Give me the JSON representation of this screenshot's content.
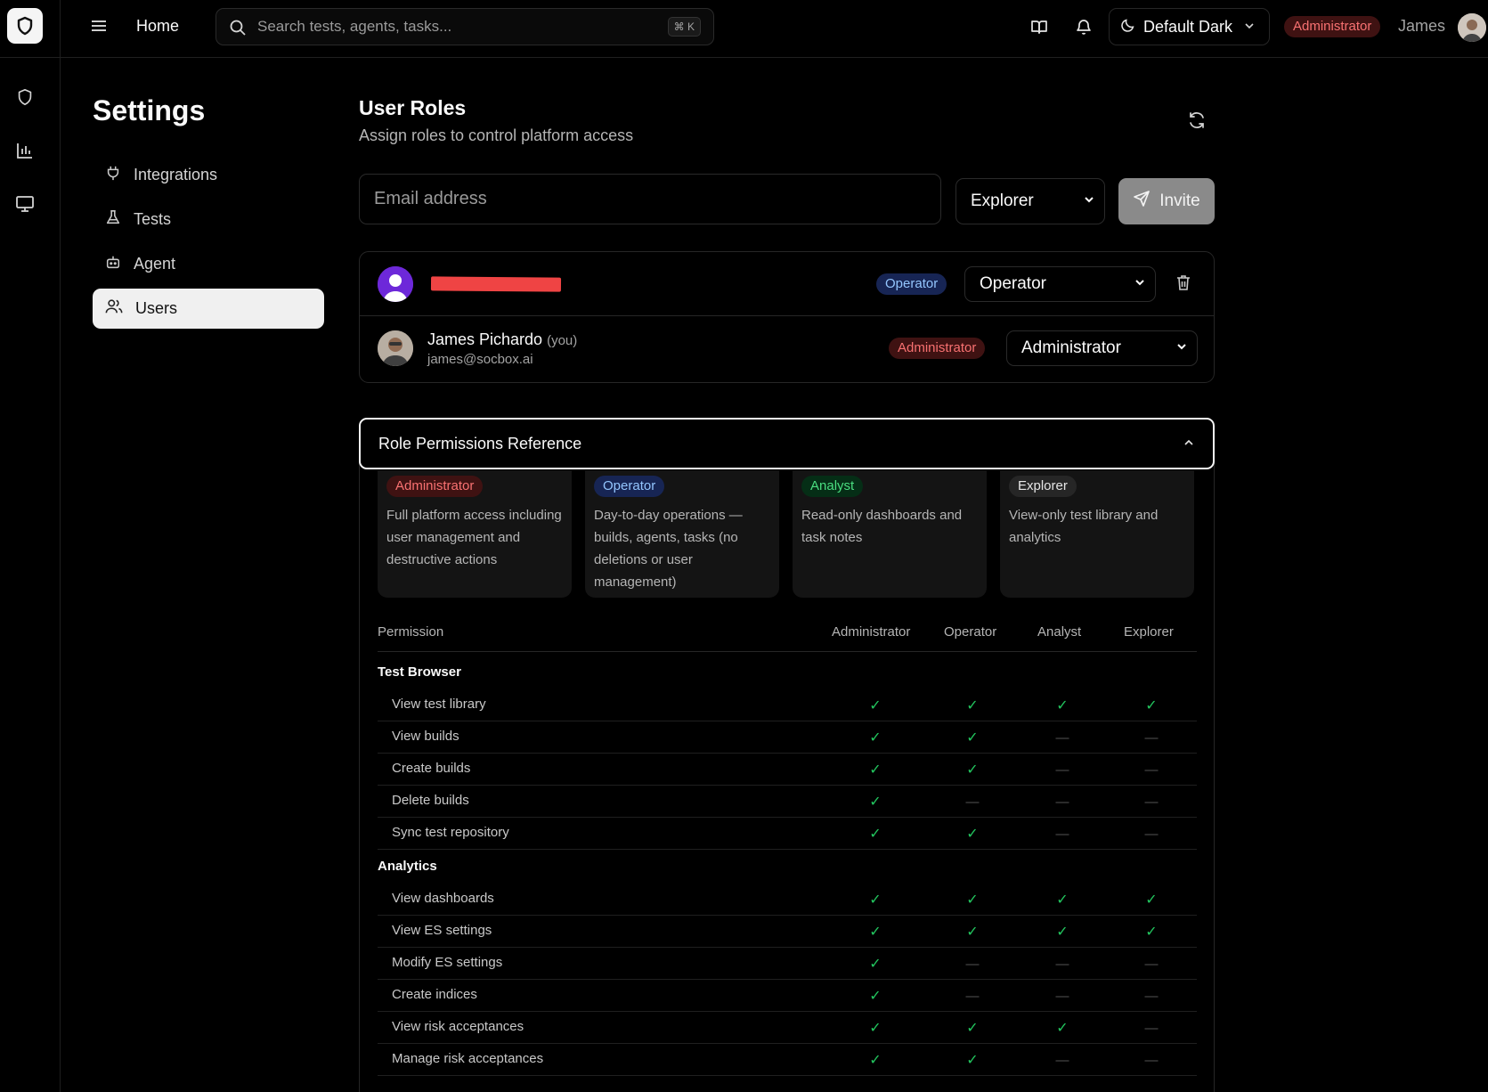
{
  "topbar": {
    "home_label": "Home",
    "search_placeholder": "Search tests, agents, tasks...",
    "shortcut": "⌘ K",
    "theme_label": "Default Dark",
    "role_badge": "Administrator",
    "user_name": "James"
  },
  "sidebar": {
    "title": "Settings",
    "items": [
      {
        "label": "Integrations",
        "icon": "plug-icon"
      },
      {
        "label": "Tests",
        "icon": "flask-icon"
      },
      {
        "label": "Agent",
        "icon": "bot-icon"
      },
      {
        "label": "Users",
        "icon": "users-icon",
        "active": true
      }
    ]
  },
  "user_roles": {
    "title": "User Roles",
    "subtitle": "Assign roles to control platform access",
    "email_placeholder": "Email address",
    "invite_role": "Explorer",
    "invite_label": "Invite",
    "users": [
      {
        "name": "",
        "badge": "Operator",
        "role": "Operator",
        "redacted": true
      },
      {
        "name": "James Pichardo",
        "you": "(you)",
        "email": "james@socbox.ai",
        "badge": "Administrator",
        "role": "Administrator"
      }
    ]
  },
  "permissions": {
    "header": "Role Permissions Reference",
    "roles": [
      {
        "name": "Administrator",
        "desc": "Full platform access including user management and destructive actions"
      },
      {
        "name": "Operator",
        "desc": "Day-to-day operations — builds, agents, tasks (no deletions or user management)"
      },
      {
        "name": "Analyst",
        "desc": "Read-only dashboards and task notes"
      },
      {
        "name": "Explorer",
        "desc": "View-only test library and analytics"
      }
    ],
    "columns": [
      "Permission",
      "Administrator",
      "Operator",
      "Analyst",
      "Explorer"
    ],
    "groups": [
      {
        "title": "Test Browser",
        "rows": [
          {
            "label": "View test library",
            "values": [
              true,
              true,
              true,
              true
            ]
          },
          {
            "label": "View builds",
            "values": [
              true,
              true,
              false,
              false
            ]
          },
          {
            "label": "Create builds",
            "values": [
              true,
              true,
              false,
              false
            ]
          },
          {
            "label": "Delete builds",
            "values": [
              true,
              false,
              false,
              false
            ]
          },
          {
            "label": "Sync test repository",
            "values": [
              true,
              true,
              false,
              false
            ]
          }
        ]
      },
      {
        "title": "Analytics",
        "rows": [
          {
            "label": "View dashboards",
            "values": [
              true,
              true,
              true,
              true
            ]
          },
          {
            "label": "View ES settings",
            "values": [
              true,
              true,
              true,
              true
            ]
          },
          {
            "label": "Modify ES settings",
            "values": [
              true,
              false,
              false,
              false
            ]
          },
          {
            "label": "Create indices",
            "values": [
              true,
              false,
              false,
              false
            ]
          },
          {
            "label": "View risk acceptances",
            "values": [
              true,
              true,
              true,
              false
            ]
          },
          {
            "label": "Manage risk acceptances",
            "values": [
              true,
              true,
              false,
              false
            ]
          }
        ]
      }
    ],
    "check_glyph": "✓",
    "dash_glyph": "—"
  },
  "colors": {
    "background": "#000000",
    "admin_badge": "#f87171",
    "operator_badge": "#93c5fd",
    "analyst_badge": "#4ade80",
    "check": "#22c55e",
    "invite_button": "#8a8a8a",
    "redaction": "#ef4444"
  }
}
